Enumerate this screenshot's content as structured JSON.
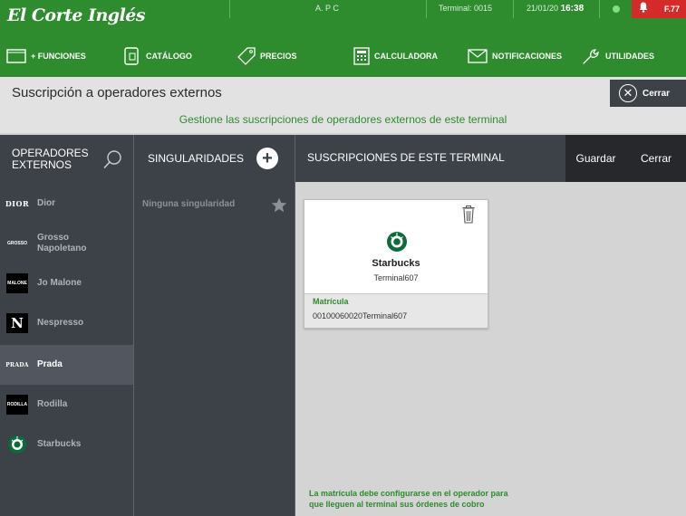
{
  "topbar": {
    "brand": "El Corte Inglés",
    "user": "A. P C",
    "terminal": "Terminal: 0015",
    "date": "21/01/20",
    "time": "16:38",
    "alert_label": "F.77",
    "status_color": "#7ee07e"
  },
  "functions": [
    {
      "label": "+ FUNCIONES",
      "icon": "window-icon"
    },
    {
      "label": "CATÁLOGO",
      "icon": "catalog-icon"
    },
    {
      "label": "PRECIOS",
      "icon": "price-tag-icon"
    },
    {
      "label": "CALCULADORA",
      "icon": "calculator-icon"
    },
    {
      "label": "NOTIFICACIONES",
      "icon": "envelope-icon"
    },
    {
      "label": "UTILIDADES",
      "icon": "wrench-icon"
    }
  ],
  "header": {
    "title": "Suscripción a operadores externos",
    "close_label": "Cerrar",
    "subtitle": "Gestione las suscripciones de operadores externos de este terminal"
  },
  "columns": {
    "operators": "OPERADORES EXTERNOS",
    "operators_line1": "OPERADORES",
    "operators_line2": "EXTERNOS",
    "singularities": "SINGULARIDADES",
    "subscriptions": "SUSCRIPCIONES DE ESTE TERMINAL",
    "save": "Guardar",
    "close": "Cerrar"
  },
  "operators": [
    {
      "name": "Dior",
      "logo": "DIOR",
      "selected": false
    },
    {
      "name": "Grosso Napoletano",
      "line1": "Grosso",
      "line2": "Napoletano",
      "logo": "GROSSO",
      "selected": false
    },
    {
      "name": "Jo Malone",
      "logo": "MALONE",
      "selected": false
    },
    {
      "name": "Nespresso",
      "logo": "N",
      "selected": false
    },
    {
      "name": "Prada",
      "logo": "PRADA",
      "selected": true
    },
    {
      "name": "Rodilla",
      "logo": "RODILLA",
      "selected": false
    },
    {
      "name": "Starbucks",
      "logo": "starbucks-logo",
      "selected": false
    }
  ],
  "singularities": {
    "empty_text": "Ninguna singularidad"
  },
  "subscription_card": {
    "name": "Starbucks",
    "terminal": "Terminal607",
    "field_label": "Matrícula",
    "field_value": "00100060020Terminal607"
  },
  "note": {
    "line1": "La matrícula debe configurarse en el operador para",
    "line2": "que lleguen al terminal sus órdenes de cobro"
  },
  "colors": {
    "brand_green": "#2e8b2e",
    "panel_dark": "#3d4148",
    "alert_red": "#d42a2a"
  }
}
